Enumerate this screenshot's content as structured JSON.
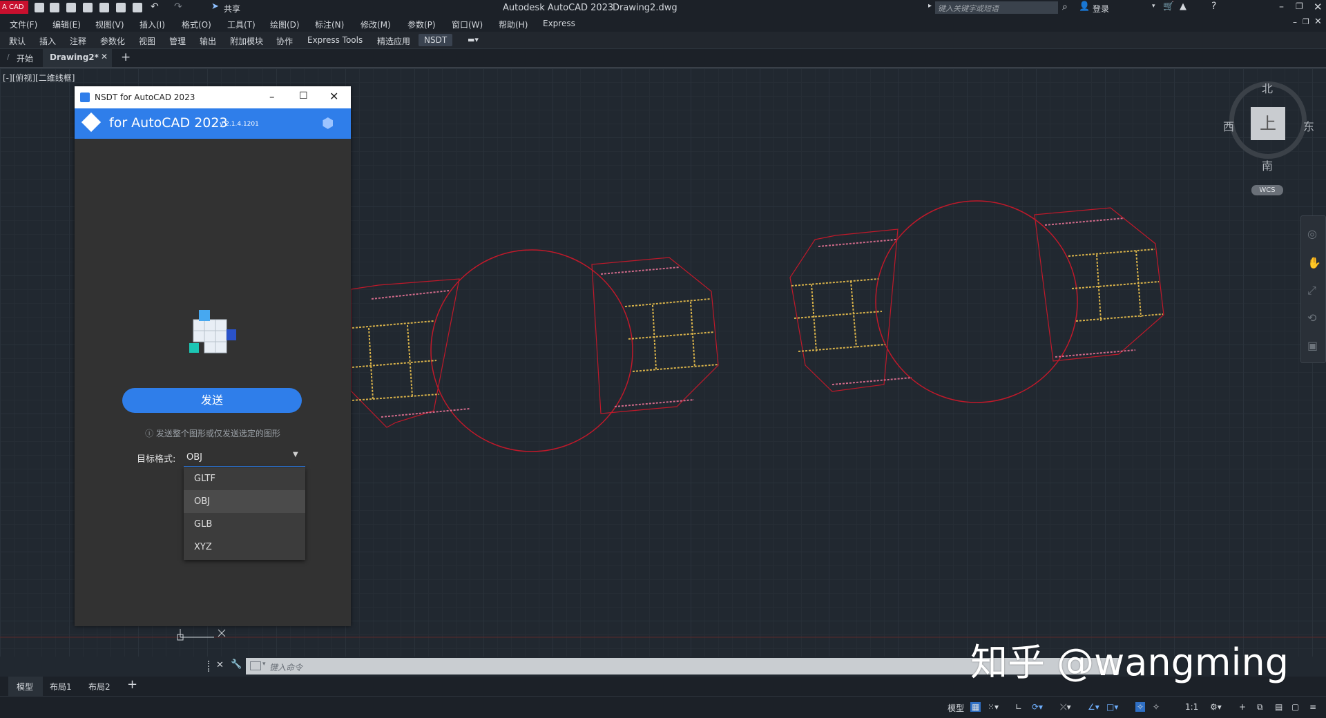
{
  "app": {
    "logo_label": "CAD",
    "share_label": "共享",
    "window_title": "Autodesk AutoCAD 2023",
    "file_name": "Drawing2.dwg",
    "search_placeholder": "键入关键字或短语",
    "login_label": "登录"
  },
  "menu": [
    "文件(F)",
    "编辑(E)",
    "视图(V)",
    "插入(I)",
    "格式(O)",
    "工具(T)",
    "绘图(D)",
    "标注(N)",
    "修改(M)",
    "参数(P)",
    "窗口(W)",
    "帮助(H)",
    "Express"
  ],
  "ribbon_tabs": [
    "默认",
    "插入",
    "注释",
    "参数化",
    "视图",
    "管理",
    "输出",
    "附加模块",
    "协作",
    "Express Tools",
    "精选应用",
    "NSDT"
  ],
  "doc_tabs": {
    "start": "开始",
    "active": "Drawing2*",
    "add": "+"
  },
  "viewport_label": "[-][俯视][二维线框]",
  "dialog": {
    "title": "NSDT for AutoCAD 2023",
    "banner_title": "for AutoCAD 2023",
    "version": "v 2.1.4.1201",
    "send_label": "发送",
    "hint": "ⓘ 发送整个图形或仅发送选定的图形",
    "format_label": "目标格式:",
    "format_value": "OBJ",
    "format_options": [
      "GLTF",
      "OBJ",
      "GLB",
      "XYZ"
    ],
    "selected_option": "OBJ"
  },
  "viewcube": {
    "north": "北",
    "south": "南",
    "west": "西",
    "east": "东",
    "face": "上",
    "wcs": "WCS"
  },
  "command_line": {
    "placeholder": "键入命令"
  },
  "layout_tabs": [
    "模型",
    "布局1",
    "布局2",
    "+"
  ],
  "status": {
    "model": "模型",
    "scale": "1:1"
  },
  "watermark": "知乎 @wangming",
  "colors": {
    "accent": "#2f7eea",
    "drawing_red": "#c0192a",
    "drawing_yellow": "#d8b24a"
  }
}
